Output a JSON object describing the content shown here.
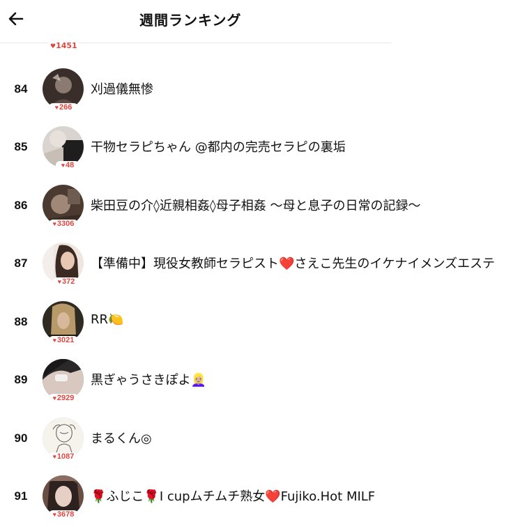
{
  "header": {
    "title": "週間ランキング",
    "back_icon": "arrow-left-icon"
  },
  "partial_row": {
    "likes": "1451"
  },
  "rows": [
    {
      "rank": "84",
      "name": "刈過儀無惨",
      "likes": "266",
      "avatar_colors": [
        "#3a2e2a",
        "#8a7a70"
      ]
    },
    {
      "rank": "85",
      "name": "干物セラピちゃん @都内の完売セラピの裏垢",
      "likes": "48",
      "avatar_colors": [
        "#d9d4cf",
        "#1e1e1e"
      ]
    },
    {
      "rank": "86",
      "name": "柴田豆の介◊近親相姦◊母子相姦 〜母と息子の日常の記録〜",
      "likes": "3306",
      "avatar_colors": [
        "#4a3a30",
        "#a08878"
      ]
    },
    {
      "rank": "87",
      "name": "【準備中】現役女教師セラピスト❤️さえこ先生のイケナイメンズエステ",
      "likes": "372",
      "avatar_colors": [
        "#efe6e0",
        "#c9a48e"
      ]
    },
    {
      "rank": "88",
      "name": "RR🍋",
      "likes": "3021",
      "avatar_colors": [
        "#2f2a22",
        "#b89a6a"
      ]
    },
    {
      "rank": "89",
      "name": "黒ぎゃうさきぽよ👱🏼‍♀️",
      "likes": "2929",
      "avatar_colors": [
        "#2a2828",
        "#d8c8c0"
      ]
    },
    {
      "rank": "90",
      "name": "まるくん◎",
      "likes": "1087",
      "avatar_colors": [
        "#f6f3ec",
        "#5a5a5a"
      ]
    },
    {
      "rank": "91",
      "name": "🌹ふじこ🌹I cupムチムチ熟女❤️Fujiko.Hot MILF",
      "likes": "3678",
      "avatar_colors": [
        "#6a4e44",
        "#e6cfc4"
      ]
    }
  ],
  "colors": {
    "likes_red": "#e2463f",
    "text": "#111111",
    "divider": "#e8e8e8"
  }
}
